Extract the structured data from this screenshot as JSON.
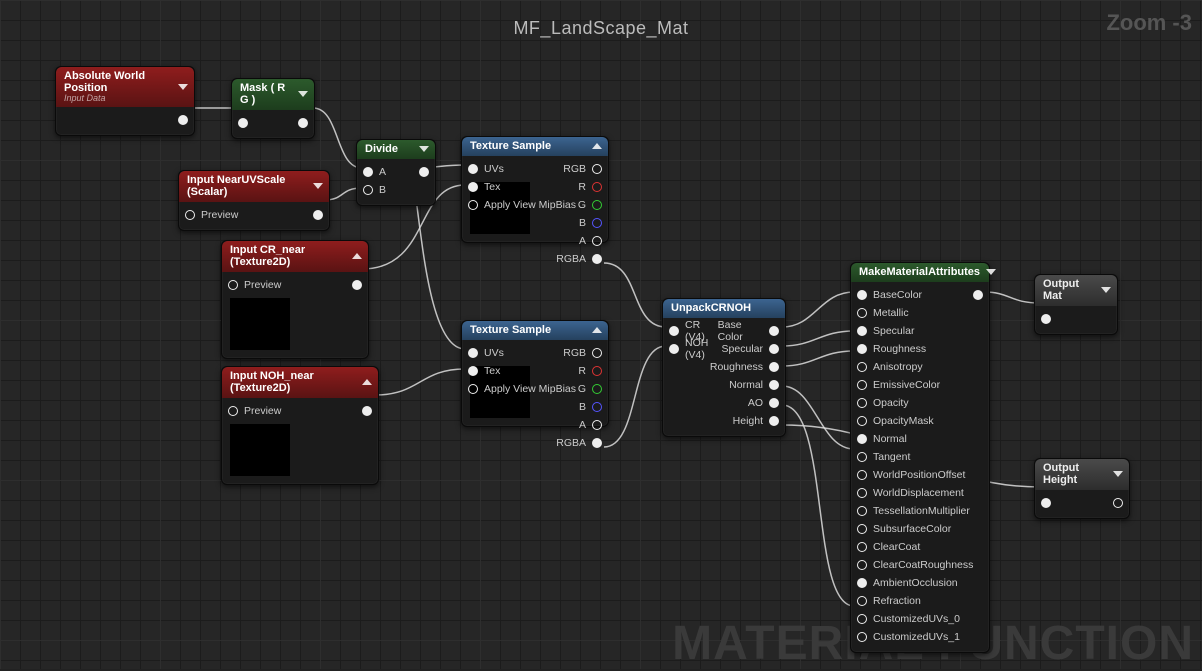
{
  "graph": {
    "title": "MF_LandScape_Mat",
    "zoom_label": "Zoom -3",
    "watermark": "MATERIAL FUNCTION"
  },
  "nodes": {
    "awp": {
      "title": "Absolute World Position",
      "subtitle": "Input Data"
    },
    "mask": {
      "title": "Mask ( R G )"
    },
    "divide": {
      "title": "Divide",
      "in_a": "A",
      "in_b": "B"
    },
    "near_uv": {
      "title": "Input NearUVScale (Scalar)",
      "preview": "Preview"
    },
    "cr_near": {
      "title": "Input CR_near (Texture2D)",
      "preview": "Preview"
    },
    "noh_near": {
      "title": "Input NOH_near (Texture2D)",
      "preview": "Preview"
    },
    "tex1": {
      "title": "Texture Sample",
      "in_uvs": "UVs",
      "in_tex": "Tex",
      "in_mip": "Apply View MipBias",
      "out_rgb": "RGB",
      "out_r": "R",
      "out_g": "G",
      "out_b": "B",
      "out_a": "A",
      "out_rgba": "RGBA"
    },
    "tex2": {
      "title": "Texture Sample",
      "in_uvs": "UVs",
      "in_tex": "Tex",
      "in_mip": "Apply View MipBias",
      "out_rgb": "RGB",
      "out_r": "R",
      "out_g": "G",
      "out_b": "B",
      "out_a": "A",
      "out_rgba": "RGBA"
    },
    "unpack": {
      "title": "UnpackCRNOH",
      "in_cr": "CR (V4)",
      "in_noh": "NOH (V4)",
      "out_base": "Base Color",
      "out_spec": "Specular",
      "out_rough": "Roughness",
      "out_norm": "Normal",
      "out_ao": "AO",
      "out_height": "Height"
    },
    "mma": {
      "title": "MakeMaterialAttributes",
      "pins": [
        "BaseColor",
        "Metallic",
        "Specular",
        "Roughness",
        "Anisotropy",
        "EmissiveColor",
        "Opacity",
        "OpacityMask",
        "Normal",
        "Tangent",
        "WorldPositionOffset",
        "WorldDisplacement",
        "TessellationMultiplier",
        "SubsurfaceColor",
        "ClearCoat",
        "ClearCoatRoughness",
        "AmbientOcclusion",
        "Refraction",
        "CustomizedUVs_0",
        "CustomizedUVs_1"
      ]
    },
    "out_mat": {
      "title": "Output Mat"
    },
    "out_height": {
      "title": "Output Height"
    }
  }
}
